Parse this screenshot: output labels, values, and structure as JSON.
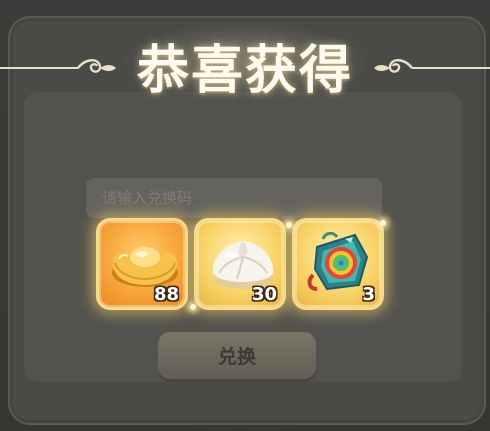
{
  "title": "恭喜获得",
  "dialog": {
    "code_placeholder": "请输入兑换码",
    "exchange_label": "兑换"
  },
  "rewards": [
    {
      "icon": "gold-ingot-icon",
      "quantity": "88"
    },
    {
      "icon": "steamed-bun-icon",
      "quantity": "30"
    },
    {
      "icon": "rainbow-pendant-icon",
      "quantity": "3"
    }
  ],
  "colors": {
    "card_border": "#f6dc86",
    "card_orange": "#f7a53a",
    "card_gold": "#f9d46a",
    "title_text": "#fffaf0"
  }
}
